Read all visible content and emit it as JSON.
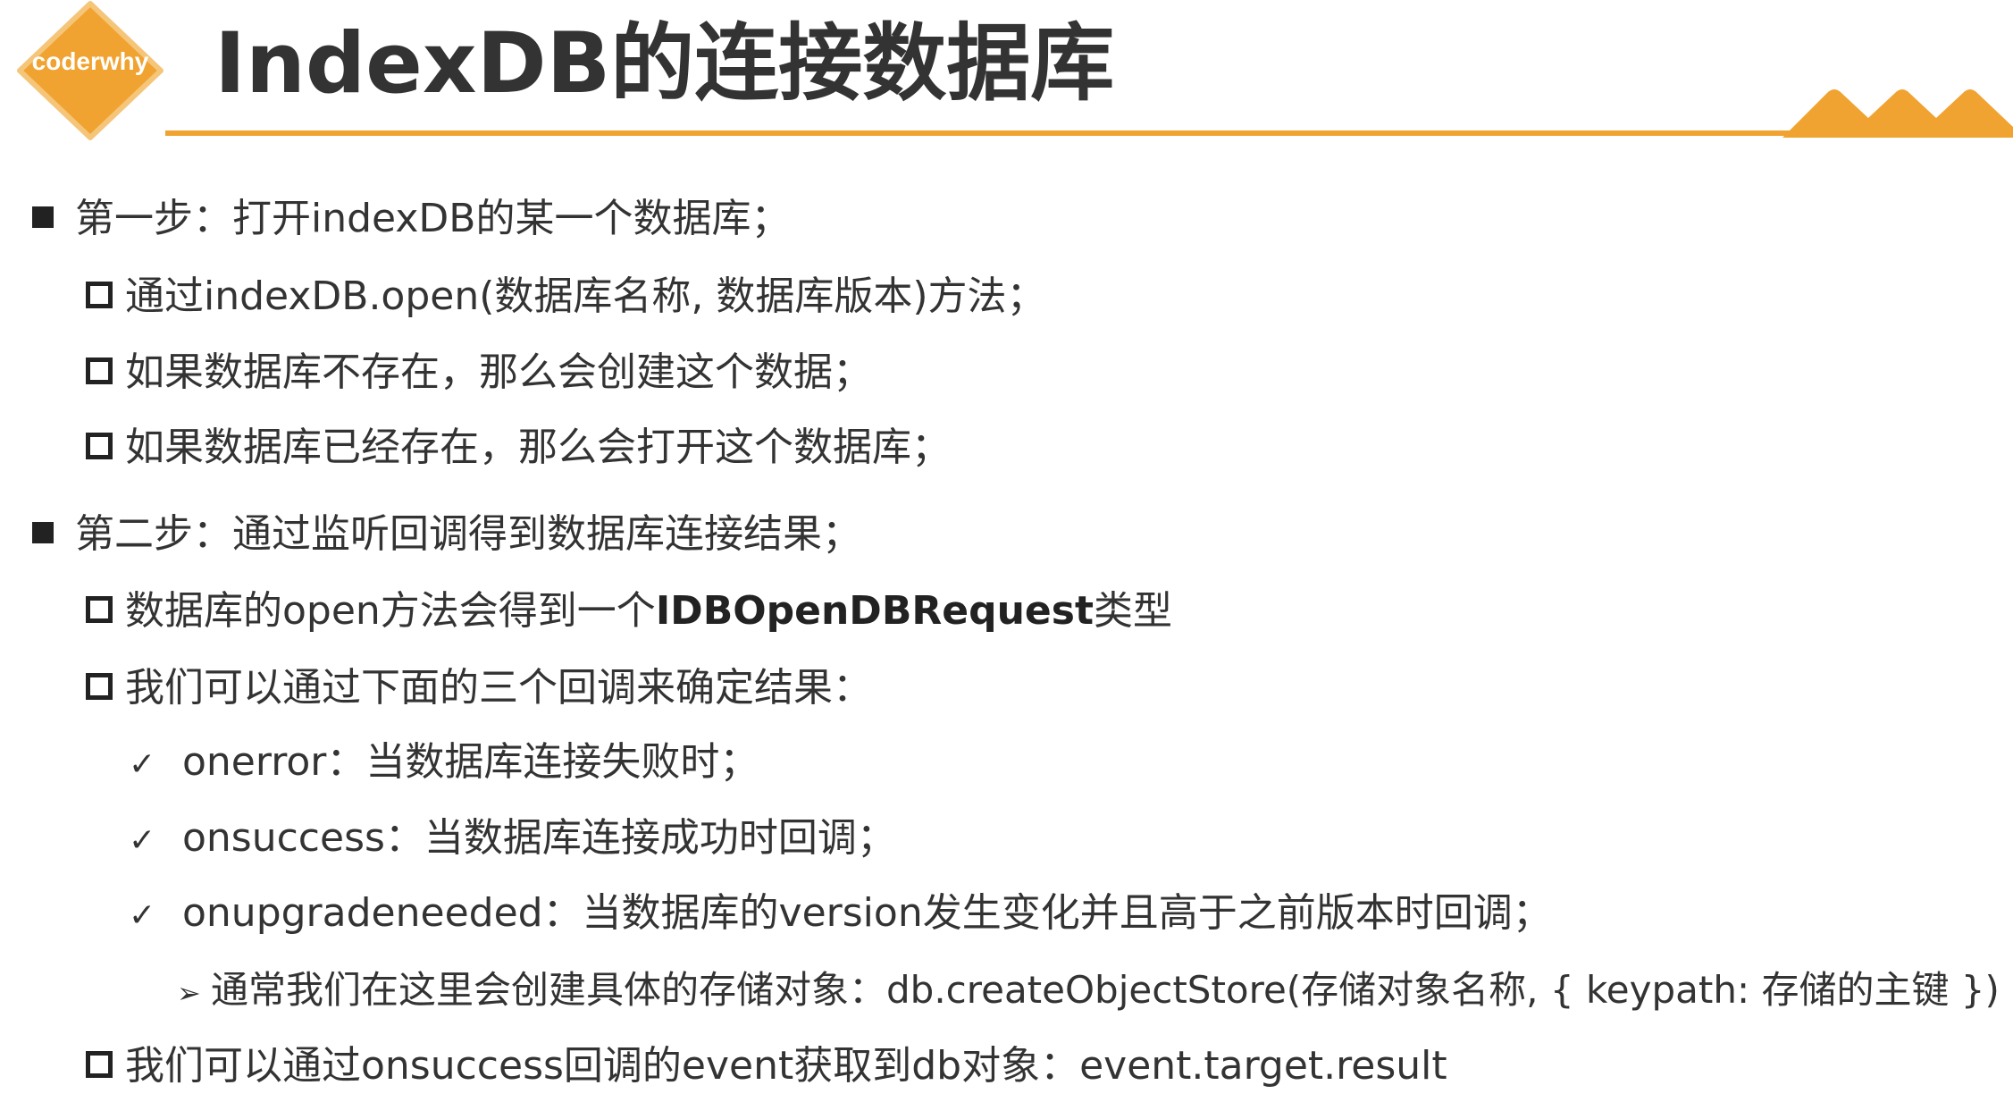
{
  "header": {
    "logo_text": "coderwhy",
    "title": "IndexDB的连接数据库"
  },
  "colors": {
    "accent": "#f0a330",
    "text": "#333333"
  },
  "items": [
    {
      "text": "第一步：打开indexDB的某一个数据库；"
    },
    {
      "text": "通过indexDB.open(数据库名称, 数据库版本)方法；"
    },
    {
      "text": "如果数据库不存在，那么会创建这个数据；"
    },
    {
      "text": "如果数据库已经存在，那么会打开这个数据库；"
    },
    {
      "text": "第二步：通过监听回调得到数据库连接结果；"
    },
    {
      "text_before": "数据库的open方法会得到一个",
      "text_bold": "IDBOpenDBRequest",
      "text_after": "类型"
    },
    {
      "text": "我们可以通过下面的三个回调来确定结果："
    },
    {
      "text": "onerror：当数据库连接失败时；"
    },
    {
      "text": "onsuccess：当数据库连接成功时回调；"
    },
    {
      "text": "onupgradeneeded：当数据库的version发生变化并且高于之前版本时回调；"
    },
    {
      "text": "通常我们在这里会创建具体的存储对象：db.createObjectStore(存储对象名称, { keypath: 存储的主键 })"
    },
    {
      "text": "我们可以通过onsuccess回调的event获取到db对象：event.target.result"
    }
  ]
}
